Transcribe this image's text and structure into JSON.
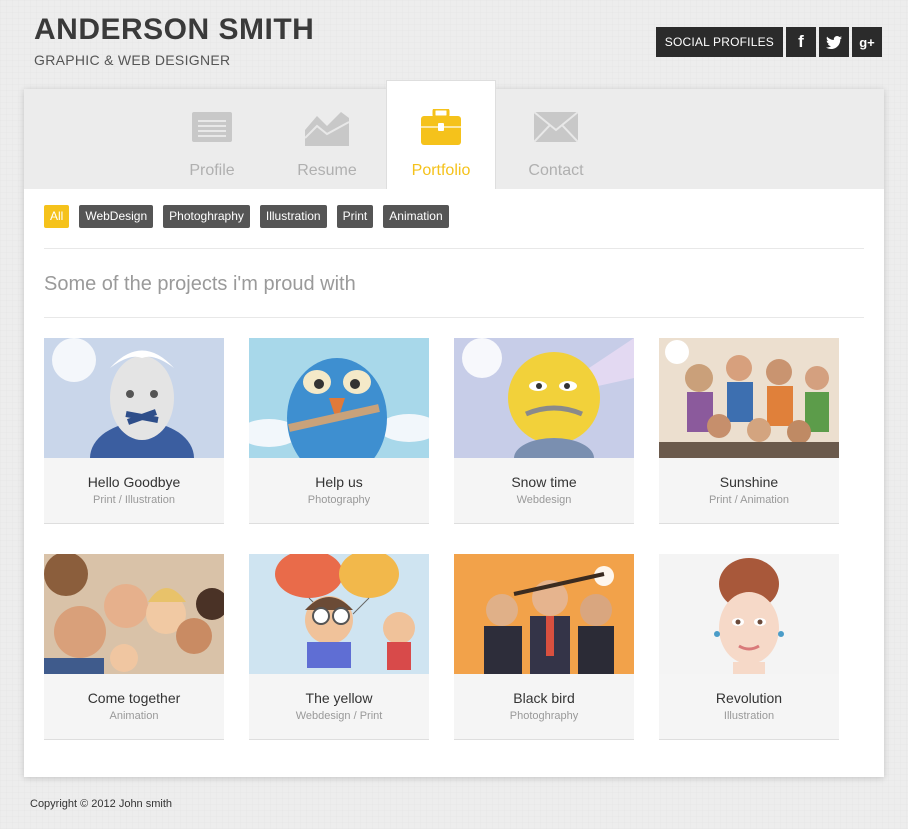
{
  "header": {
    "title": "ANDERSON SMITH",
    "subtitle": "GRAPHIC & WEB DESIGNER"
  },
  "social": {
    "label": "SOCIAL PROFILES",
    "facebook": "f",
    "twitter": "twitter-bird-icon",
    "google_plus": "g+"
  },
  "tabs": [
    {
      "label": "Profile",
      "icon": "profile-card-icon"
    },
    {
      "label": "Resume",
      "icon": "chart-icon"
    },
    {
      "label": "Portfolio",
      "icon": "briefcase-icon",
      "active": true
    },
    {
      "label": "Contact",
      "icon": "envelope-icon"
    }
  ],
  "filters": [
    {
      "label": "All",
      "active": true
    },
    {
      "label": "WebDesign"
    },
    {
      "label": "Photoghraphy"
    },
    {
      "label": "Illustration"
    },
    {
      "label": "Print"
    },
    {
      "label": "Animation"
    }
  ],
  "section_title": "Some of the projects i'm proud with",
  "projects": [
    {
      "title": "Hello Goodbye",
      "category": "Print / Illustration"
    },
    {
      "title": "Help us",
      "category": "Photography"
    },
    {
      "title": "Snow time",
      "category": "Webdesign"
    },
    {
      "title": "Sunshine",
      "category": "Print / Animation"
    },
    {
      "title": "Come together",
      "category": "Animation"
    },
    {
      "title": "The yellow",
      "category": "Webdesign / Print"
    },
    {
      "title": "Black bird",
      "category": "Photoghraphy"
    },
    {
      "title": "Revolution",
      "category": "Illustration"
    }
  ],
  "footer": "Copyright © 2012 John smith",
  "colors": {
    "accent": "#f5c21b",
    "dark": "#2b2b2b",
    "filter": "#555555"
  }
}
